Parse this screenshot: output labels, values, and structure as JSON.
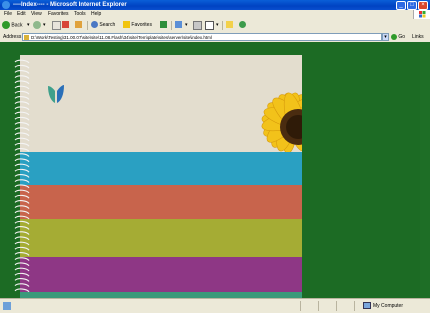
{
  "window": {
    "title": "----Index---- - Microsoft Internet Explorer",
    "minimize_glyph": "_",
    "maximize_glyph": "□",
    "close_glyph": "×"
  },
  "menu": [
    "File",
    "Edit",
    "View",
    "Favorites",
    "Tools",
    "Help"
  ],
  "toolbar": {
    "back_label": "Back",
    "search_label": "Search",
    "favorites_label": "Favorites"
  },
  "address": {
    "label": "Address",
    "url": "D:\\Work\\Testing\\31.00.07\\site\\site\\11.08.Flash\\34\\site\\Tem\\plate\\sites\\server\\site\\index.html",
    "go_label": "Go",
    "links_label": "Links"
  },
  "status": {
    "zone": "My Computer"
  },
  "colors": {
    "page_background": "#1c6b24",
    "paper": "#e3ddce",
    "band_teal": "#2aa0c2",
    "band_salmon": "#c8644c",
    "band_olive": "#a5ac34",
    "band_purple": "#8e3785",
    "band_green": "#3b9a7a"
  }
}
